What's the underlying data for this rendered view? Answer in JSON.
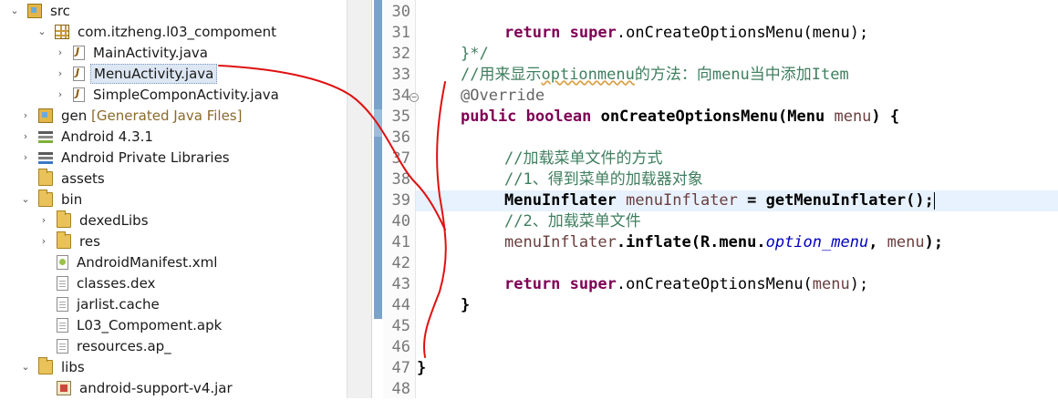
{
  "tree": {
    "items": [
      {
        "label": "src"
      },
      {
        "label": "com.itzheng.l03_compoment"
      },
      {
        "label": "MainActivity.java"
      },
      {
        "label": "MenuActivity.java"
      },
      {
        "label": "SimpleComponActivity.java"
      },
      {
        "label": "gen",
        "extra": "[Generated Java Files]"
      },
      {
        "label": "Android 4.3.1"
      },
      {
        "label": "Android Private Libraries"
      },
      {
        "label": "assets"
      },
      {
        "label": "bin"
      },
      {
        "label": "dexedLibs"
      },
      {
        "label": "res"
      },
      {
        "label": "AndroidManifest.xml"
      },
      {
        "label": "classes.dex"
      },
      {
        "label": "jarlist.cache"
      },
      {
        "label": "L03_Compoment.apk"
      },
      {
        "label": "resources.ap_"
      },
      {
        "label": "libs"
      },
      {
        "label": "android-support-v4.jar"
      }
    ]
  },
  "editor": {
    "line_numbers": [
      "30",
      "31",
      "32",
      "33",
      "34",
      "35",
      "36",
      "37",
      "38",
      "39",
      "40",
      "41",
      "42",
      "43",
      "44",
      "45",
      "46",
      "47",
      "48"
    ],
    "code": {
      "l31": {
        "kw": "return",
        "kw2": "super",
        "rest": ".onCreateOptionsMenu(menu);"
      },
      "l32": {
        "text": "}*/"
      },
      "l33": {
        "pre": "//用来显示",
        "sq": "optionmenu",
        "post": "的方法：向menu当中添加Item"
      },
      "l34": {
        "text": "@Override"
      },
      "l35": {
        "kw1": "public",
        "kw2": "boolean",
        "name": "onCreateOptionsMenu(Menu",
        "param": "menu",
        "tail": ") {"
      },
      "l37": {
        "text": "//加载菜单文件的方式"
      },
      "l38": {
        "text": "//1、得到菜单的加载器对象"
      },
      "l39": {
        "type": "MenuInflater",
        "var": "menuInflater",
        "rest": " = getMenuInflater();"
      },
      "l40": {
        "text": "//2、加载菜单文件"
      },
      "l41": {
        "var": "menuInflater",
        "mid": ".inflate(R.menu.",
        "fld": "option_menu",
        "tail": ", ",
        "var2": "menu",
        "end": ");"
      },
      "l43": {
        "kw": "return",
        "kw2": "super",
        "rest": ".onCreateOptionsMenu(",
        "var": "menu",
        "end": ");"
      },
      "l44": {
        "text": "}"
      },
      "l47": {
        "text": "}"
      }
    }
  }
}
